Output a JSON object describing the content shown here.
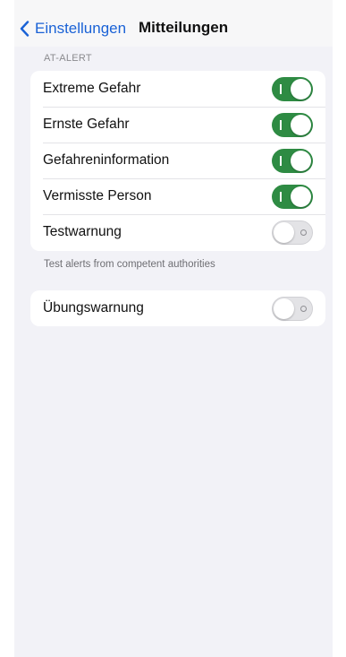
{
  "nav": {
    "back_label": "Einstellungen",
    "title": "Mitteilungen"
  },
  "at_alert": {
    "header": "AT-ALERT",
    "footer": "Test alerts from competent authorities",
    "rows": [
      {
        "label": "Extreme Gefahr",
        "on": true
      },
      {
        "label": "Ernste Gefahr",
        "on": true
      },
      {
        "label": "Gefahreninformation",
        "on": true
      },
      {
        "label": "Vermisste Person",
        "on": true
      },
      {
        "label": "Testwarnung",
        "on": false
      }
    ]
  },
  "exercise": {
    "rows": [
      {
        "label": "Übungswarnung",
        "on": false
      }
    ]
  },
  "colors": {
    "accent": "#1a62d6",
    "toggle_on": "#2e8b43",
    "background": "#f2f2f7"
  }
}
